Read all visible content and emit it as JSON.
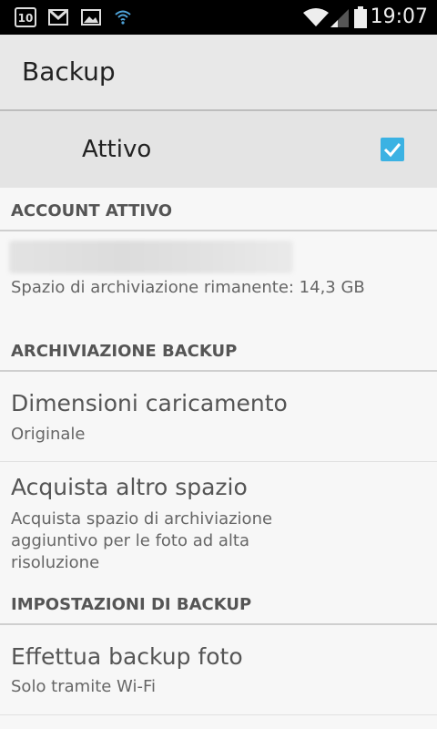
{
  "status_bar": {
    "calendar_day": "10",
    "time": "19:07",
    "icons": [
      "calendar-icon",
      "gmail-icon",
      "image-icon",
      "wifi-icon",
      "wifi-signal-icon",
      "cell-signal-icon",
      "battery-icon"
    ]
  },
  "app_bar": {
    "title": "Backup"
  },
  "master_switch": {
    "label": "Attivo",
    "checked": true,
    "accent": "#3bb2e3"
  },
  "sections": {
    "account": {
      "header": "ACCOUNT ATTIVO",
      "storage_summary": "Spazio di archiviazione rimanente: 14,3 GB"
    },
    "storage": {
      "header": "ARCHIVIAZIONE BACKUP",
      "upload_size": {
        "title": "Dimensioni caricamento",
        "summary": "Originale"
      },
      "buy_storage": {
        "title": "Acquista altro spazio",
        "summary": "Acquista spazio di archiviazione aggiuntivo per le foto ad alta risoluzione"
      }
    },
    "settings": {
      "header": "IMPOSTAZIONI DI BACKUP",
      "backup_photos": {
        "title": "Effettua backup foto",
        "summary": "Solo tramite Wi-Fi"
      }
    }
  }
}
